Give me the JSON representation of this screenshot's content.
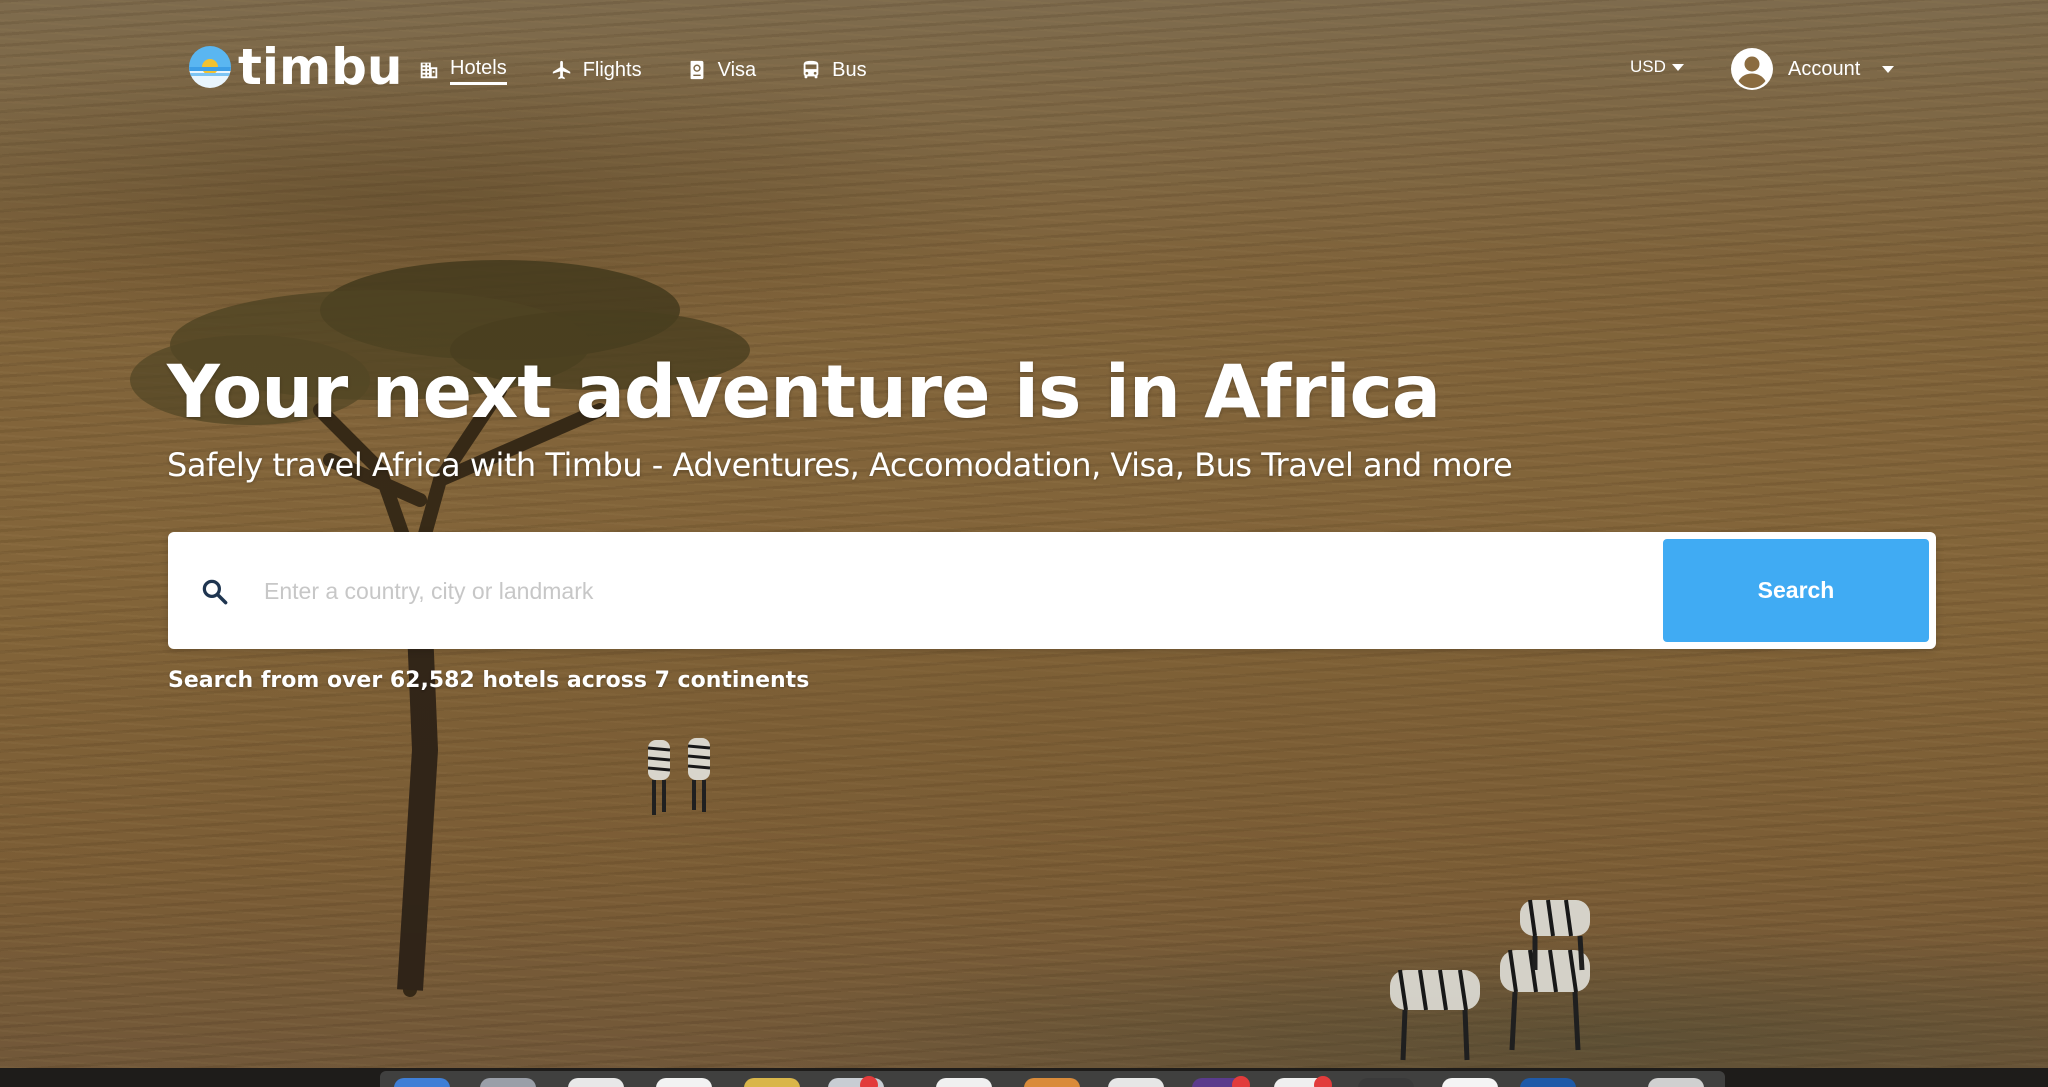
{
  "brand": {
    "name": "timbu"
  },
  "nav": {
    "items": [
      {
        "label": "Hotels",
        "icon": "building-icon",
        "active": true
      },
      {
        "label": "Flights",
        "icon": "plane-icon",
        "active": false
      },
      {
        "label": "Visa",
        "icon": "passport-icon",
        "active": false
      },
      {
        "label": "Bus",
        "icon": "bus-icon",
        "active": false
      }
    ]
  },
  "currency": {
    "label": "USD",
    "icon": "caret-down-icon"
  },
  "account": {
    "label": "Account",
    "icon": "user-circle-icon"
  },
  "hero": {
    "title": "Your next adventure is in Africa",
    "subtitle": "Safely travel Africa with Timbu - Adventures, Accomodation, Visa, Bus Travel and more"
  },
  "search": {
    "placeholder": "Enter a country, city or landmark",
    "value": "",
    "button_label": "Search",
    "stats": "Search from over 62,582 hotels across 7 continents"
  },
  "colors": {
    "accent": "#40abf3",
    "text_on_hero": "#ffffff",
    "placeholder": "#c7c7c7"
  }
}
